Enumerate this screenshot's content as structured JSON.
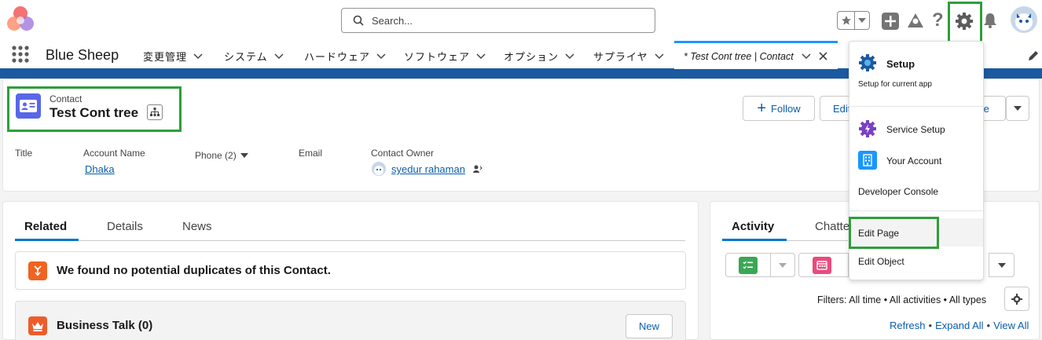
{
  "header": {
    "search_placeholder": "Search..."
  },
  "nav": {
    "app_name": "Blue Sheep",
    "items": [
      {
        "label": "変更管理"
      },
      {
        "label": "システム"
      },
      {
        "label": "ハードウェア"
      },
      {
        "label": "ソフトウェア"
      },
      {
        "label": "オプション"
      },
      {
        "label": "サプライヤ"
      }
    ],
    "active_tab": "* Test Cont tree | Contact"
  },
  "record": {
    "object_label": "Contact",
    "name": "Test Cont tree",
    "follow_label": "Follow",
    "edit_label": "Edit",
    "delete_partial": "te",
    "fields": {
      "title_label": "Title",
      "account_label": "Account Name",
      "account_value": "Dhaka",
      "phone_label": "Phone (2)",
      "email_label": "Email",
      "owner_label": "Contact Owner",
      "owner_value": "syedur rahaman"
    }
  },
  "related": {
    "tabs": [
      "Related",
      "Details",
      "News"
    ],
    "duplicates_text": "We found no potential duplicates of this Contact.",
    "business_talk_title": "Business Talk (0)",
    "new_label": "New"
  },
  "activity": {
    "tabs": [
      "Activity",
      "Chatte"
    ],
    "filters_text": "Filters: All time • All activities • All types",
    "refresh": "Refresh",
    "expand_all": "Expand All",
    "view_all": "View All",
    "sep": "•"
  },
  "setup_menu": {
    "setup_title": "Setup",
    "setup_sub": "Setup for current app",
    "service_setup": "Service Setup",
    "your_account": "Your Account",
    "developer_console": "Developer Console",
    "edit_page": "Edit Page",
    "edit_object": "Edit Object"
  },
  "colors": {
    "brand_blue": "#0176d3",
    "highlight_green": "#2e9e3a",
    "nav_band": "#1b5aa0",
    "contact_icon": "#5867e8"
  }
}
